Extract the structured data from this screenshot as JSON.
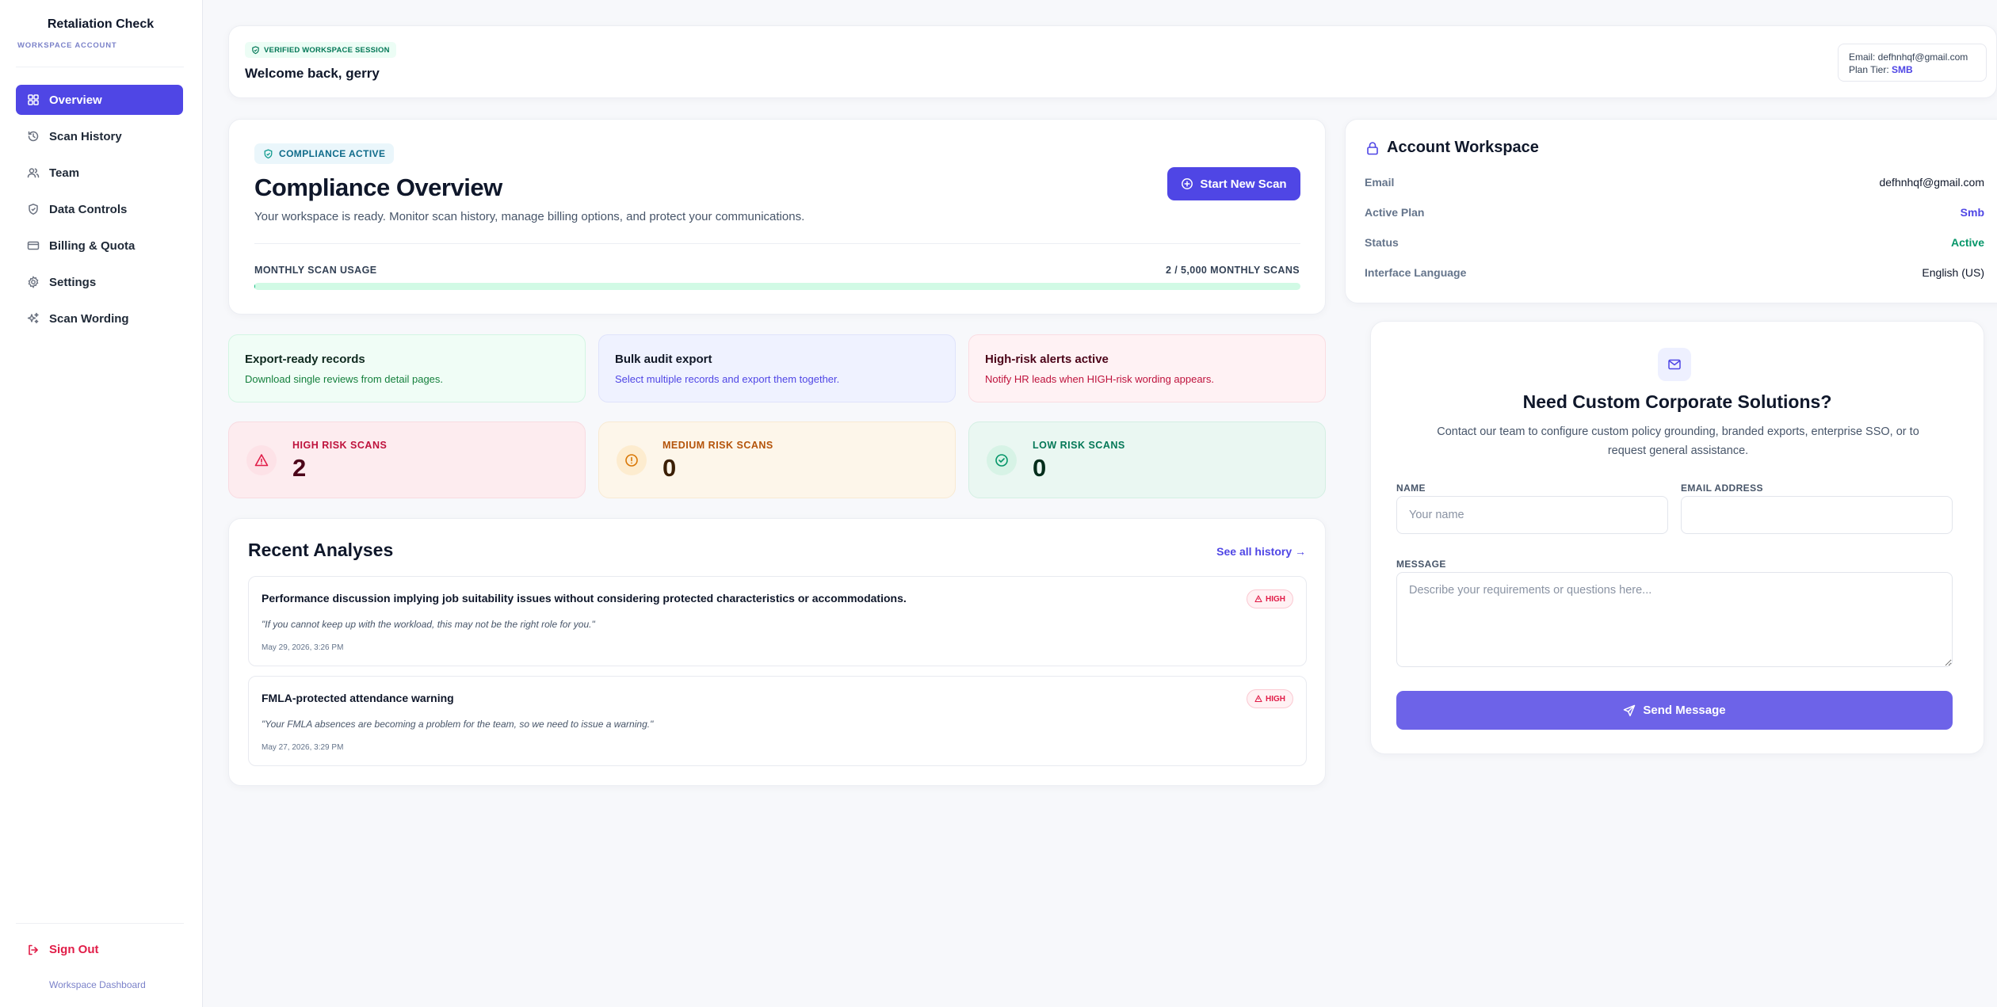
{
  "sidebar": {
    "brand_title": "Retaliation Check",
    "brand_subtitle": "WORKSPACE ACCOUNT",
    "items": [
      {
        "label": "Overview",
        "icon": "grid-icon",
        "active": true
      },
      {
        "label": "Scan History",
        "icon": "history-icon",
        "active": false
      },
      {
        "label": "Team",
        "icon": "users-icon",
        "active": false
      },
      {
        "label": "Data Controls",
        "icon": "shield-icon",
        "active": false
      },
      {
        "label": "Billing & Quota",
        "icon": "credit-card-icon",
        "active": false
      },
      {
        "label": "Settings",
        "icon": "gear-icon",
        "active": false
      },
      {
        "label": "Scan Wording",
        "icon": "sparkles-icon",
        "active": false
      }
    ],
    "sign_out_label": "Sign Out",
    "footer_label": "Workspace Dashboard"
  },
  "header": {
    "verified_label": "VERIFIED WORKSPACE SESSION",
    "welcome": "Welcome back, gerry",
    "email_line": "Email: defhnhqf@gmail.com",
    "plan_tier_prefix": "Plan Tier: ",
    "plan_tier_value": "SMB"
  },
  "overview": {
    "badge": "COMPLIANCE ACTIVE",
    "title": "Compliance Overview",
    "description": "Your workspace is ready. Monitor scan history, manage billing options, and protect your communications.",
    "start_button": "Start New Scan",
    "usage_label": "MONTHLY SCAN USAGE",
    "usage_value": "2 / 5,000 MONTHLY SCANS",
    "usage_fraction": 0.0004
  },
  "tiles": [
    {
      "title": "Export-ready records",
      "description": "Download single reviews from detail pages."
    },
    {
      "title": "Bulk audit export",
      "description": "Select multiple records and export them together."
    },
    {
      "title": "High-risk alerts active",
      "description": "Notify HR leads when HIGH-risk wording appears."
    }
  ],
  "stats": {
    "high": {
      "label": "HIGH RISK SCANS",
      "value": "2"
    },
    "medium": {
      "label": "MEDIUM RISK SCANS",
      "value": "0"
    },
    "low": {
      "label": "LOW RISK SCANS",
      "value": "0"
    }
  },
  "recent": {
    "title": "Recent Analyses",
    "see_all": "See all history →",
    "items": [
      {
        "title": "Performance discussion implying job suitability issues without considering protected characteristics or accommodations.",
        "quote": "\"If you cannot keep up with the workload, this may not be the right role for you.\"",
        "date": "May 29, 2026, 3:26 PM",
        "badge": "HIGH"
      },
      {
        "title": "FMLA-protected attendance warning",
        "quote": "\"Your FMLA absences are becoming a problem for the team, so we need to issue a warning.\"",
        "date": "May 27, 2026, 3:29 PM",
        "badge": "HIGH"
      }
    ]
  },
  "workspace": {
    "title": "Account Workspace",
    "rows": [
      {
        "key": "Email",
        "value": "defhnhqf@gmail.com"
      },
      {
        "key": "Active Plan",
        "value": "Smb"
      },
      {
        "key": "Status",
        "value": "Active"
      },
      {
        "key": "Interface Language",
        "value": "English (US)"
      }
    ]
  },
  "contact": {
    "title": "Need Custom Corporate Solutions?",
    "description": "Contact our team to configure custom policy grounding, branded exports, enterprise SSO, or to request general assistance.",
    "name_label": "NAME",
    "name_placeholder": "Your name",
    "email_label": "EMAIL ADDRESS",
    "email_placeholder": "",
    "message_label": "MESSAGE",
    "message_placeholder": "Describe your requirements or questions here...",
    "send_button": "Send Message"
  },
  "colors": {
    "accent": "#4f46e5",
    "success": "#059669",
    "danger": "#e11d48",
    "warning": "#d97706"
  }
}
